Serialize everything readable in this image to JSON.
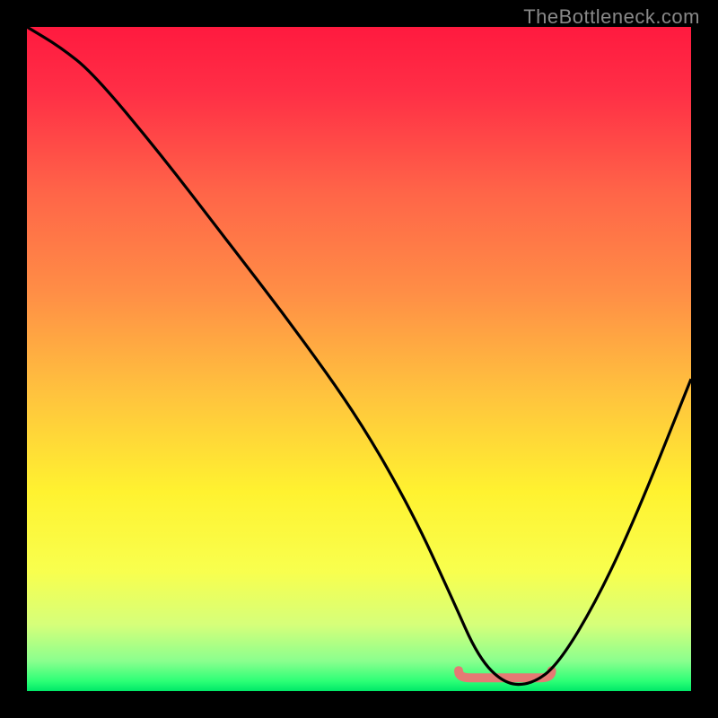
{
  "watermark": {
    "text": "TheBottleneck.com"
  },
  "chart_data": {
    "type": "line",
    "title": "",
    "xlabel": "",
    "ylabel": "",
    "xlim": [
      0,
      100
    ],
    "ylim": [
      0,
      100
    ],
    "grid": false,
    "series": [
      {
        "name": "bottleneck-curve",
        "x": [
          0,
          5,
          10,
          20,
          30,
          40,
          50,
          58,
          64,
          68,
          72,
          76,
          80,
          86,
          92,
          100
        ],
        "values": [
          100,
          97,
          93,
          81,
          68,
          55,
          41,
          27,
          14,
          5,
          1,
          1,
          4,
          14,
          27,
          47
        ]
      }
    ],
    "annotations": [
      {
        "name": "optimal-segment",
        "type": "segment",
        "x_start": 65,
        "x_end": 79,
        "y": 2,
        "color": "#e47a74",
        "thickness": 10
      }
    ],
    "gradient_stops": [
      {
        "offset": 0.0,
        "color": "#ff1a3f"
      },
      {
        "offset": 0.1,
        "color": "#ff2f46"
      },
      {
        "offset": 0.25,
        "color": "#ff6548"
      },
      {
        "offset": 0.4,
        "color": "#ff8e46"
      },
      {
        "offset": 0.55,
        "color": "#ffc23e"
      },
      {
        "offset": 0.7,
        "color": "#fff230"
      },
      {
        "offset": 0.82,
        "color": "#f8ff4e"
      },
      {
        "offset": 0.9,
        "color": "#d6ff7a"
      },
      {
        "offset": 0.955,
        "color": "#8aff8e"
      },
      {
        "offset": 0.985,
        "color": "#2dff76"
      },
      {
        "offset": 1.0,
        "color": "#00e868"
      }
    ]
  }
}
